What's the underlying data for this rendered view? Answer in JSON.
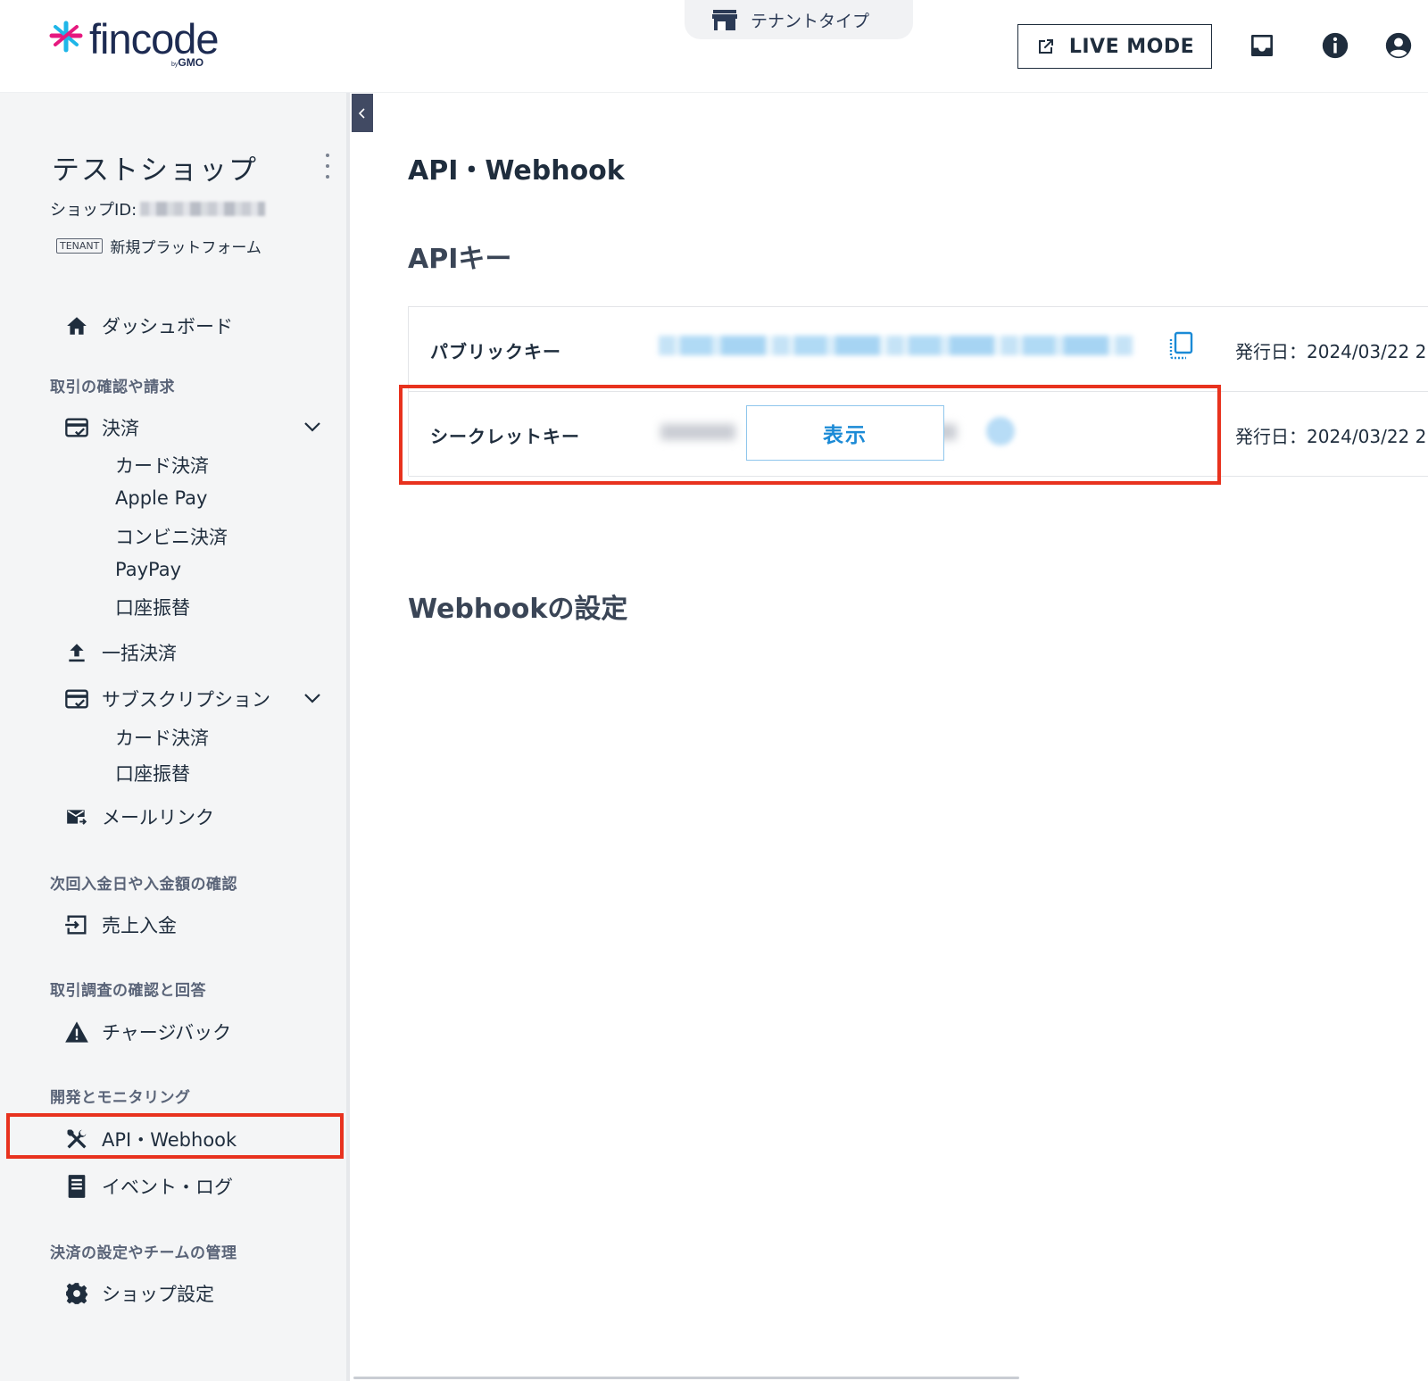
{
  "header": {
    "logo_text": "fincode",
    "logo_by": "by",
    "logo_brand": "GMO",
    "tenant_type_label": "テナントタイプ",
    "live_mode_label": "LIVE MODE"
  },
  "sidebar": {
    "shop_name": "テストショップ",
    "shop_id_label": "ショップID:",
    "tenant_tag": "TENANT",
    "tenant_name": "新規プラットフォーム",
    "dashboard": "ダッシュボード",
    "sections": {
      "transactions": "取引の確認や請求",
      "deposits": "次回入金日や入金額の確認",
      "disputes": "取引調査の確認と回答",
      "dev": "開発とモニタリング",
      "settings": "決済の設定やチームの管理"
    },
    "payments": {
      "label": "決済",
      "items": [
        "カード決済",
        "Apple Pay",
        "コンビニ決済",
        "PayPay",
        "口座振替"
      ]
    },
    "bulk_payment": "一括決済",
    "subscription": {
      "label": "サブスクリプション",
      "items": [
        "カード決済",
        "口座振替"
      ]
    },
    "mail_link": "メールリンク",
    "sales_deposit": "売上入金",
    "chargeback": "チャージバック",
    "api_webhook": "API・Webhook",
    "event_log": "イベント・ログ",
    "shop_settings": "ショップ設定"
  },
  "main": {
    "title": "API・Webhook",
    "api_keys_heading": "APIキー",
    "public_key_label": "パブリックキー",
    "secret_key_label": "シークレットキー",
    "show_button": "表示",
    "public_issued": "発行日：2024/03/22 2",
    "secret_issued": "発行日：2024/03/22 2",
    "webhook_heading": "Webhookの設定"
  },
  "colors": {
    "highlight": "#e8321e",
    "accent": "#1b8ad6",
    "logo_navy": "#1d2b52",
    "logo_pink": "#e6197f",
    "logo_cyan": "#1fb6e8"
  },
  "icons": [
    "store-icon",
    "external-link-icon",
    "inbox-icon",
    "info-icon",
    "account-icon",
    "home-icon",
    "payment-icon",
    "upload-icon",
    "mail-icon",
    "deposit-icon",
    "warning-icon",
    "tools-icon",
    "log-icon",
    "gear-icon",
    "copy-icon",
    "chevron-left-icon",
    "chevron-down-icon"
  ]
}
